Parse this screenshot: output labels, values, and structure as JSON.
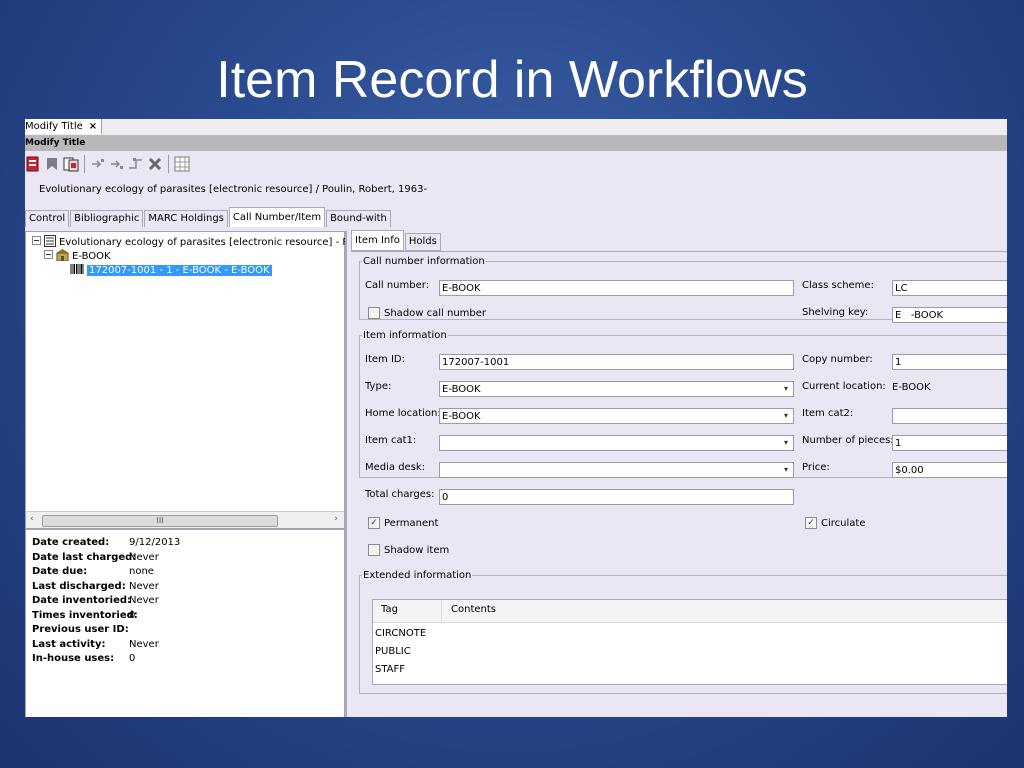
{
  "slide_title": "Item Record in Workflows",
  "doc_tab": {
    "label": "Modify Title",
    "close": "×"
  },
  "window_title": "Modify Title",
  "record_title": "Evolutionary ecology of parasites [electronic resource] / Poulin, Robert, 1963-",
  "tabs": [
    "Control",
    "Bibliographic",
    "MARC Holdings",
    "Call Number/Item",
    "Bound-with"
  ],
  "tree": {
    "root": "Evolutionary ecology of parasites [electronic resource] - Poulin,",
    "library": "E-BOOK",
    "item": "172007-1001 - 1 - E-BOOK - E-BOOK"
  },
  "scrollbar": {
    "thumb_label": "III",
    "left": "‹",
    "right": "›"
  },
  "stats": [
    {
      "label": "Date created:",
      "value": "9/12/2013"
    },
    {
      "label": "Date last charged:",
      "value": "Never"
    },
    {
      "label": "Date due:",
      "value": "none"
    },
    {
      "label": "Last discharged:",
      "value": "Never"
    },
    {
      "label": "Date inventoried:",
      "value": "Never"
    },
    {
      "label": "Times inventoried:",
      "value": "0"
    },
    {
      "label": "Previous user ID:",
      "value": ""
    },
    {
      "label": "Last activity:",
      "value": "Never"
    },
    {
      "label": "In-house uses:",
      "value": "0"
    }
  ],
  "subtabs": [
    "Item Info",
    "Holds"
  ],
  "call_number_info": {
    "legend": "Call number information",
    "call_number_label": "Call number:",
    "call_number": "E-BOOK",
    "class_scheme_label": "Class scheme:",
    "class_scheme": "LC",
    "shadow_call_label": "Shadow call number",
    "shadow_call_checked": false,
    "shelving_key_label": "Shelving key:",
    "shelving_key": "E   -BOOK"
  },
  "item_info": {
    "legend": "Item information",
    "item_id_label": "Item ID:",
    "item_id": "172007-1001",
    "copy_number_label": "Copy number:",
    "copy_number": "1",
    "type_label": "Type:",
    "type": "E-BOOK",
    "current_location_label": "Current location:",
    "current_location": "E-BOOK",
    "home_location_label": "Home location:",
    "home_location": "E-BOOK",
    "item_cat2_label": "Item cat2:",
    "item_cat2": "",
    "item_cat1_label": "Item cat1:",
    "item_cat1": "",
    "pieces_label": "Number of pieces:",
    "pieces": "1",
    "media_desk_label": "Media desk:",
    "media_desk": "",
    "price_label": "Price:",
    "price": "$0.00",
    "total_charges_label": "Total charges:",
    "total_charges": "0",
    "permanent_label": "Permanent",
    "permanent_checked": true,
    "circulate_label": "Circulate",
    "circulate_checked": true,
    "shadow_item_label": "Shadow item",
    "shadow_item_checked": false
  },
  "extended_info": {
    "legend": "Extended information",
    "col_tag": "Tag",
    "col_contents": "Contents",
    "rows": [
      "CIRCNOTE",
      "PUBLIC",
      "STAFF"
    ]
  },
  "check_glyph": "✓",
  "dropdown_glyph": "▾"
}
